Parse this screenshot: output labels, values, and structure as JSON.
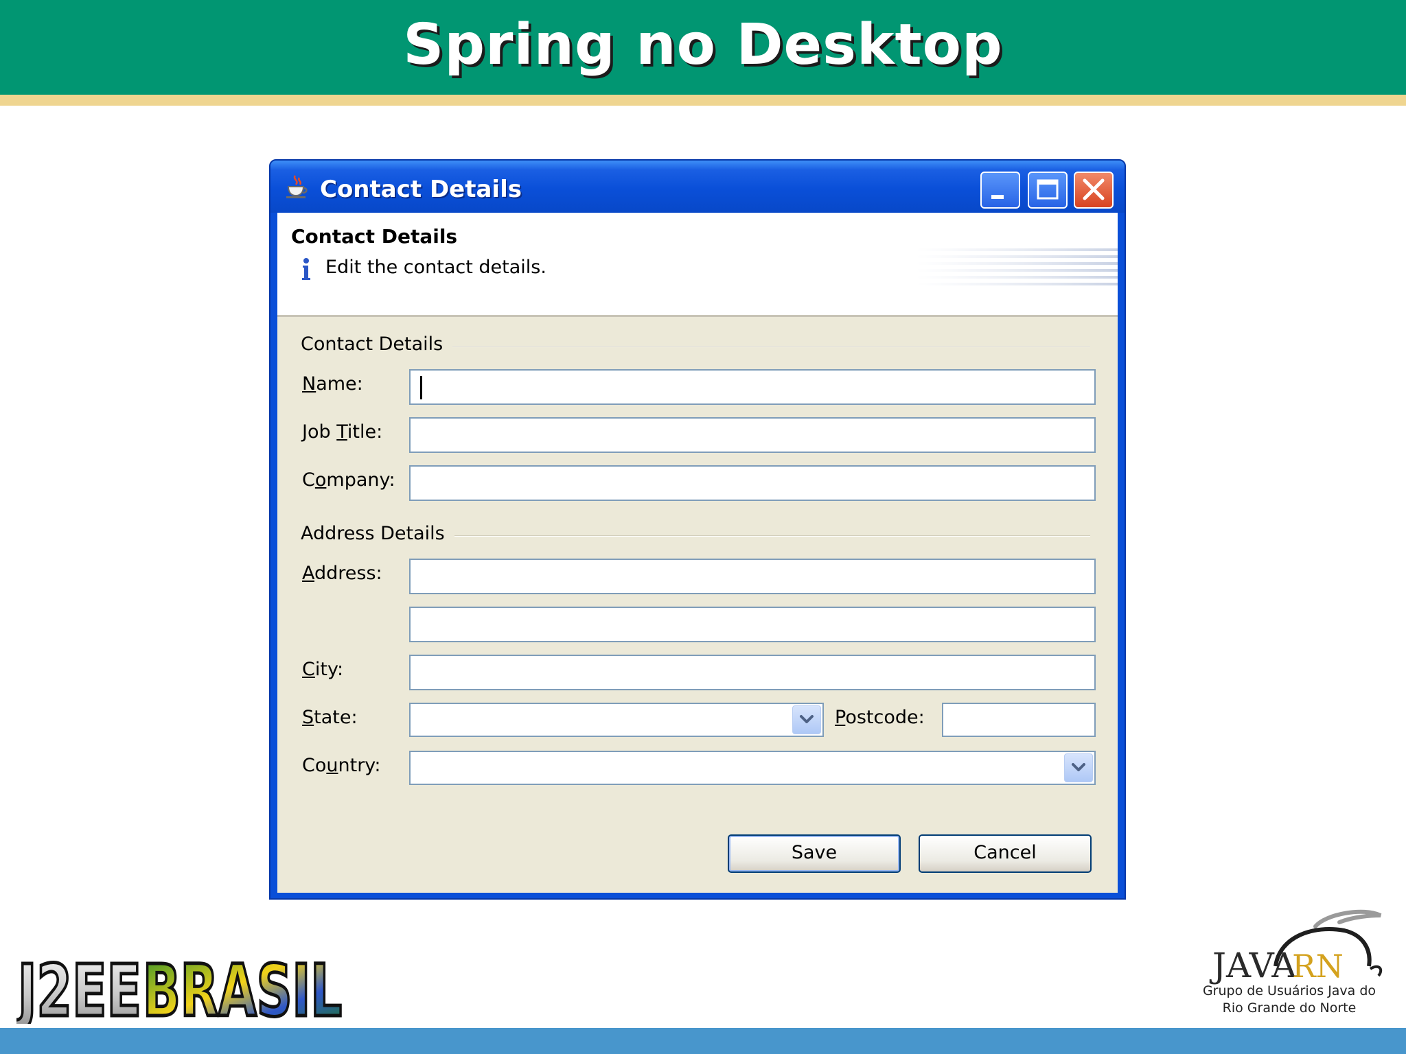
{
  "slide": {
    "title": "Spring no Desktop"
  },
  "window": {
    "title": "Contact Details",
    "controls": {
      "minimize": "minimize",
      "maximize": "maximize",
      "close": "close"
    }
  },
  "banner": {
    "title": "Contact Details",
    "message": "Edit the contact details."
  },
  "sections": {
    "contact": "Contact Details",
    "address": "Address Details"
  },
  "fields": {
    "name": {
      "label_u": "N",
      "label_rest": "ame:",
      "value": ""
    },
    "job_title": {
      "label_pre": "Job ",
      "label_u": "T",
      "label_rest": "itle:",
      "value": ""
    },
    "company": {
      "label_pre": "C",
      "label_u": "o",
      "label_rest": "mpany:",
      "value": ""
    },
    "address": {
      "label_u": "A",
      "label_rest": "ddress:",
      "line1": "",
      "line2": ""
    },
    "city": {
      "label_u": "C",
      "label_rest": "ity:",
      "value": ""
    },
    "state": {
      "label_u": "S",
      "label_rest": "tate:",
      "value": ""
    },
    "postcode": {
      "label_u": "P",
      "label_rest": "ostcode:",
      "value": ""
    },
    "country": {
      "label_pre": "Co",
      "label_u": "u",
      "label_rest": "ntry:",
      "value": ""
    }
  },
  "buttons": {
    "save": "Save",
    "cancel": "Cancel"
  },
  "logos": {
    "j2ee": "J2EEBRASIL",
    "javarn_java": "JAVA",
    "javarn_rn": "RN",
    "javarn_caption_line1": "Grupo de Usuários Java do",
    "javarn_caption_line2": "Rio Grande do Norte"
  },
  "colors": {
    "slide_header": "#019672",
    "slide_stripe": "#efd590",
    "footer_bar": "#4896cc",
    "window_blue": "#0a4fd8",
    "dialog_bg": "#ece9d8"
  }
}
